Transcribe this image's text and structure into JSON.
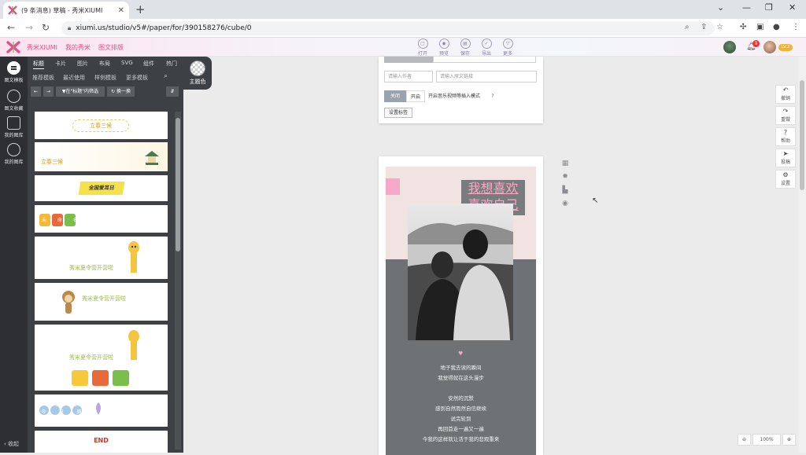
{
  "browser": {
    "tab_title": "(9 条消息) 草稿 - 秀米XIUMI",
    "url": "xiumi.us/studio/v5#/paper/for/390158276/cube/0"
  },
  "header": {
    "brand": "秀米XIUMI",
    "nav": [
      "我的秀米",
      "图文排版"
    ],
    "tools": [
      {
        "icon": "open-icon",
        "label": "打开"
      },
      {
        "icon": "preview-icon",
        "label": "预览"
      },
      {
        "icon": "save-icon",
        "label": "保存"
      },
      {
        "icon": "export-icon",
        "label": "导出"
      },
      {
        "icon": "more-icon",
        "label": "更多"
      }
    ],
    "notif_count": "9",
    "level_badge": "LV.2"
  },
  "rail": {
    "items": [
      "图文模板",
      "图文收藏",
      "我的图库",
      "我的图库"
    ],
    "collapse": "收起"
  },
  "panel": {
    "tabs": [
      "标题",
      "卡片",
      "图片",
      "布局",
      "SVG",
      "组件",
      "热门"
    ],
    "subtabs": [
      "推荐模板",
      "最近使用",
      "样例模板",
      "更多模板"
    ],
    "filter_label": "▼在\"标题\"内筛选",
    "swap_label": "换一换",
    "theme_color": "主题色",
    "templates": [
      {
        "text": "立春三候"
      },
      {
        "text": "立春三候"
      },
      {
        "text": "全国爱耳日"
      },
      {
        "text": "未 命 名"
      },
      {
        "text": "秀米夏令营开营啦"
      },
      {
        "text": "秀米夏令营开营啦"
      },
      {
        "text": "秀米夏令营开营啦"
      },
      {
        "text": "今 日 周 末"
      },
      {
        "text": "END"
      }
    ]
  },
  "editor": {
    "author_placeholder": "请输入作者",
    "origin_placeholder": "请输入原文链接",
    "toggle_off": "关闭",
    "toggle_on": "开启",
    "toggle_desc": "开启音乐视频等插入模式",
    "help_mark": "?",
    "set_title_btn": "设置标签"
  },
  "poster": {
    "headline": [
      "我想喜欢",
      "喜欢自己"
    ],
    "heart": "♥",
    "paragraph1": [
      "地子我去读的瞬间",
      "我觉得就在这头漫步"
    ],
    "paragraph2": [
      "安然的沉默",
      "感到自然而然自信继续",
      "说完轮到",
      "再回首走一遍又一遍",
      "今我的这样就让活于我的悲观重来"
    ]
  },
  "side_tools": [
    {
      "icon": "undo-icon",
      "label": "撤销"
    },
    {
      "icon": "redo-icon",
      "label": "重做"
    },
    {
      "icon": "help-icon",
      "label": "帮助"
    },
    {
      "icon": "submit-icon",
      "label": "投稿"
    },
    {
      "icon": "settings-icon",
      "label": "设置"
    }
  ],
  "zoom": {
    "value": "100%"
  },
  "colors": {
    "accent": "#e0508a",
    "poster_pink": "#f6a8c6",
    "poster_grey": "#6e7274",
    "panel_bg": "#3d4044"
  }
}
